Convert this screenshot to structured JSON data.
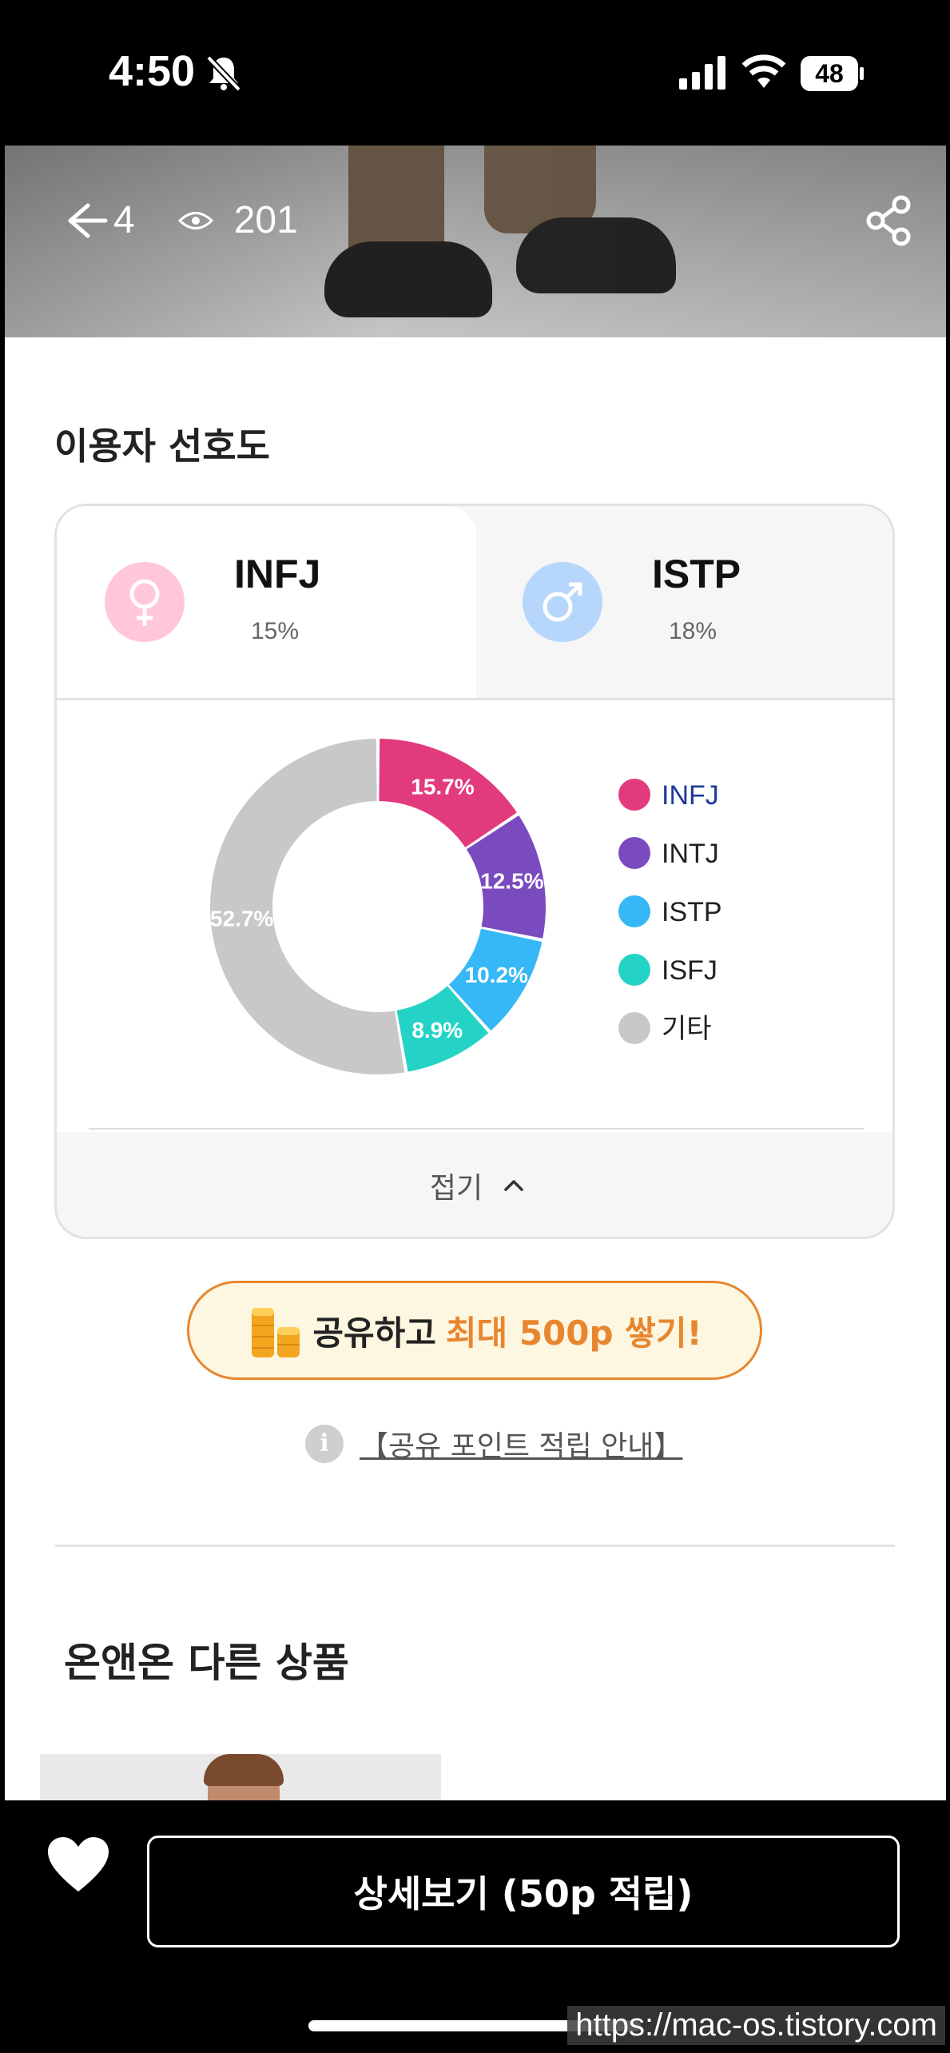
{
  "status_bar": {
    "time": "4:50",
    "battery": "48"
  },
  "hero": {
    "share_count": "4",
    "view_count": "201"
  },
  "preference": {
    "title": "이용자 선호도",
    "female": {
      "type": "INFJ",
      "percent": "15%"
    },
    "male": {
      "type": "ISTP",
      "percent": "18%"
    },
    "fold_label": "접기"
  },
  "chart_data": {
    "type": "pie",
    "donut": true,
    "categories": [
      "INFJ",
      "INTJ",
      "ISTP",
      "ISFJ",
      "기타"
    ],
    "values": [
      15.7,
      12.5,
      10.2,
      8.9,
      52.7
    ],
    "labels": [
      "15.7%",
      "12.5%",
      "10.2%",
      "8.9%",
      "52.7%"
    ],
    "colors": [
      "#e23b7d",
      "#7a4bbf",
      "#35b8f5",
      "#25d3c6",
      "#c8c8c8"
    ],
    "legend_placement": "right"
  },
  "promo": {
    "text": "공유하고",
    "accent": "최대 500p 쌓기!"
  },
  "info_link": "【공유 포인트 적립 안내】",
  "other_products_title": "온앤온 다른 상품",
  "bottom": {
    "detail_button": "상세보기 (50p 적립)"
  },
  "watermark": "https://mac-os.tistory.com"
}
